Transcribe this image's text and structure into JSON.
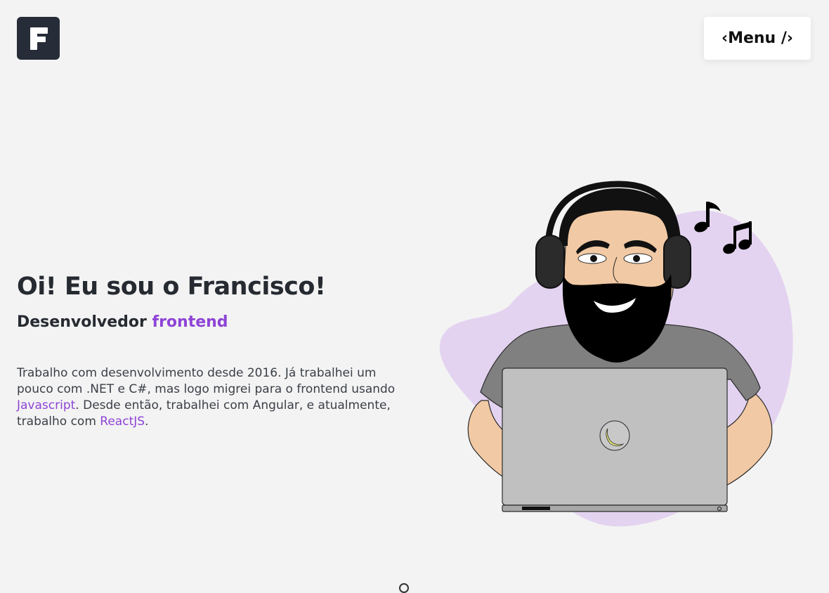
{
  "header": {
    "logo_letter": "F",
    "menu_label": "‹Menu /›"
  },
  "hero": {
    "title": "Oi! Eu sou o Francisco!",
    "subtitle_prefix": "Desenvolvedor ",
    "subtitle_accent": "frontend",
    "description": {
      "part1": "Trabalho com desenvolvimento desde 2016. Já trabalhei um pouco com .NET e C#, mas logo migrei para o frontend usando ",
      "link1": "Javascript",
      "part2": ". Desde então, trabalhei com Angular, e atualmente, trabalho com ",
      "link2": "ReactJS",
      "part3": "."
    }
  },
  "illustration": {
    "name": "developer-with-headphones-illustration",
    "icons": [
      "music-note-icon",
      "double-music-note-icon",
      "banana-logo-icon"
    ]
  },
  "colors": {
    "background": "#f3f3f3",
    "accent": "#8e44d6",
    "logo_bg": "#262d38",
    "blob": "#e3d3f0"
  }
}
